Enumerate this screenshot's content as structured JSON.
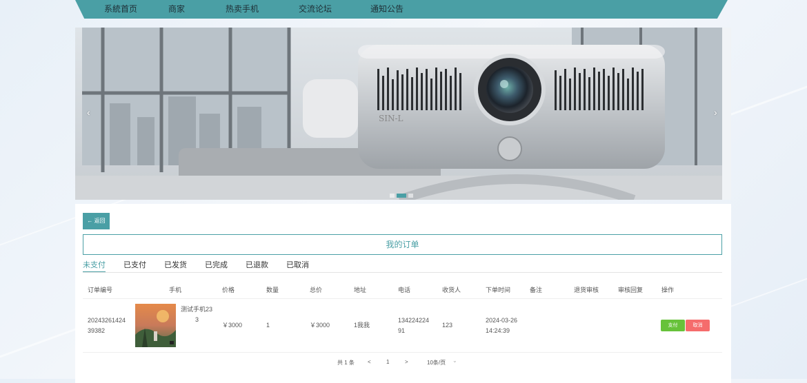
{
  "nav": {
    "items": [
      "系統首页",
      "商家",
      "热卖手机",
      "交流论坛",
      "通知公告"
    ]
  },
  "carousel": {
    "prev_icon": "chevron-left-icon",
    "next_icon": "chevron-right-icon",
    "prev_glyph": "‹",
    "next_glyph": "›",
    "dot_count": 3,
    "active_dot": 1,
    "banner_text": "SIN-L"
  },
  "back_label": "← 返回",
  "page_title": "我的订单",
  "tabs": [
    "未支付",
    "已支付",
    "已发货",
    "已完成",
    "已退款",
    "已取消"
  ],
  "active_tab": 0,
  "table": {
    "headers": [
      "订单编号",
      "手机",
      "价格",
      "数量",
      "总价",
      "地址",
      "电话",
      "收货人",
      "下单时间",
      "备注",
      "退货审核",
      "审核回复",
      "操作"
    ],
    "rows": [
      {
        "order_no_1": "20243261424",
        "order_no_2": "39382",
        "phone_name_1": "测试手机23",
        "phone_name_2": "3",
        "price": "￥3000",
        "quantity": "1",
        "total": "￥3000",
        "address": "1我我",
        "tel_1": "134224224",
        "tel_2": "91",
        "receiver": "123",
        "time_1": "2024-03-26",
        "time_2": "14:24:39",
        "remark": "",
        "return_audit": "",
        "audit_reply": "",
        "pay_label": "支付",
        "cancel_label": "取消"
      }
    ]
  },
  "pagination": {
    "total": "共 1 条",
    "prev": "<",
    "page": "1",
    "next": ">",
    "page_size": "10条/页",
    "dropdown": "⌄"
  },
  "colors": {
    "accent": "#4a9fa5",
    "pay": "#67c23a",
    "cancel": "#f56c6c"
  }
}
